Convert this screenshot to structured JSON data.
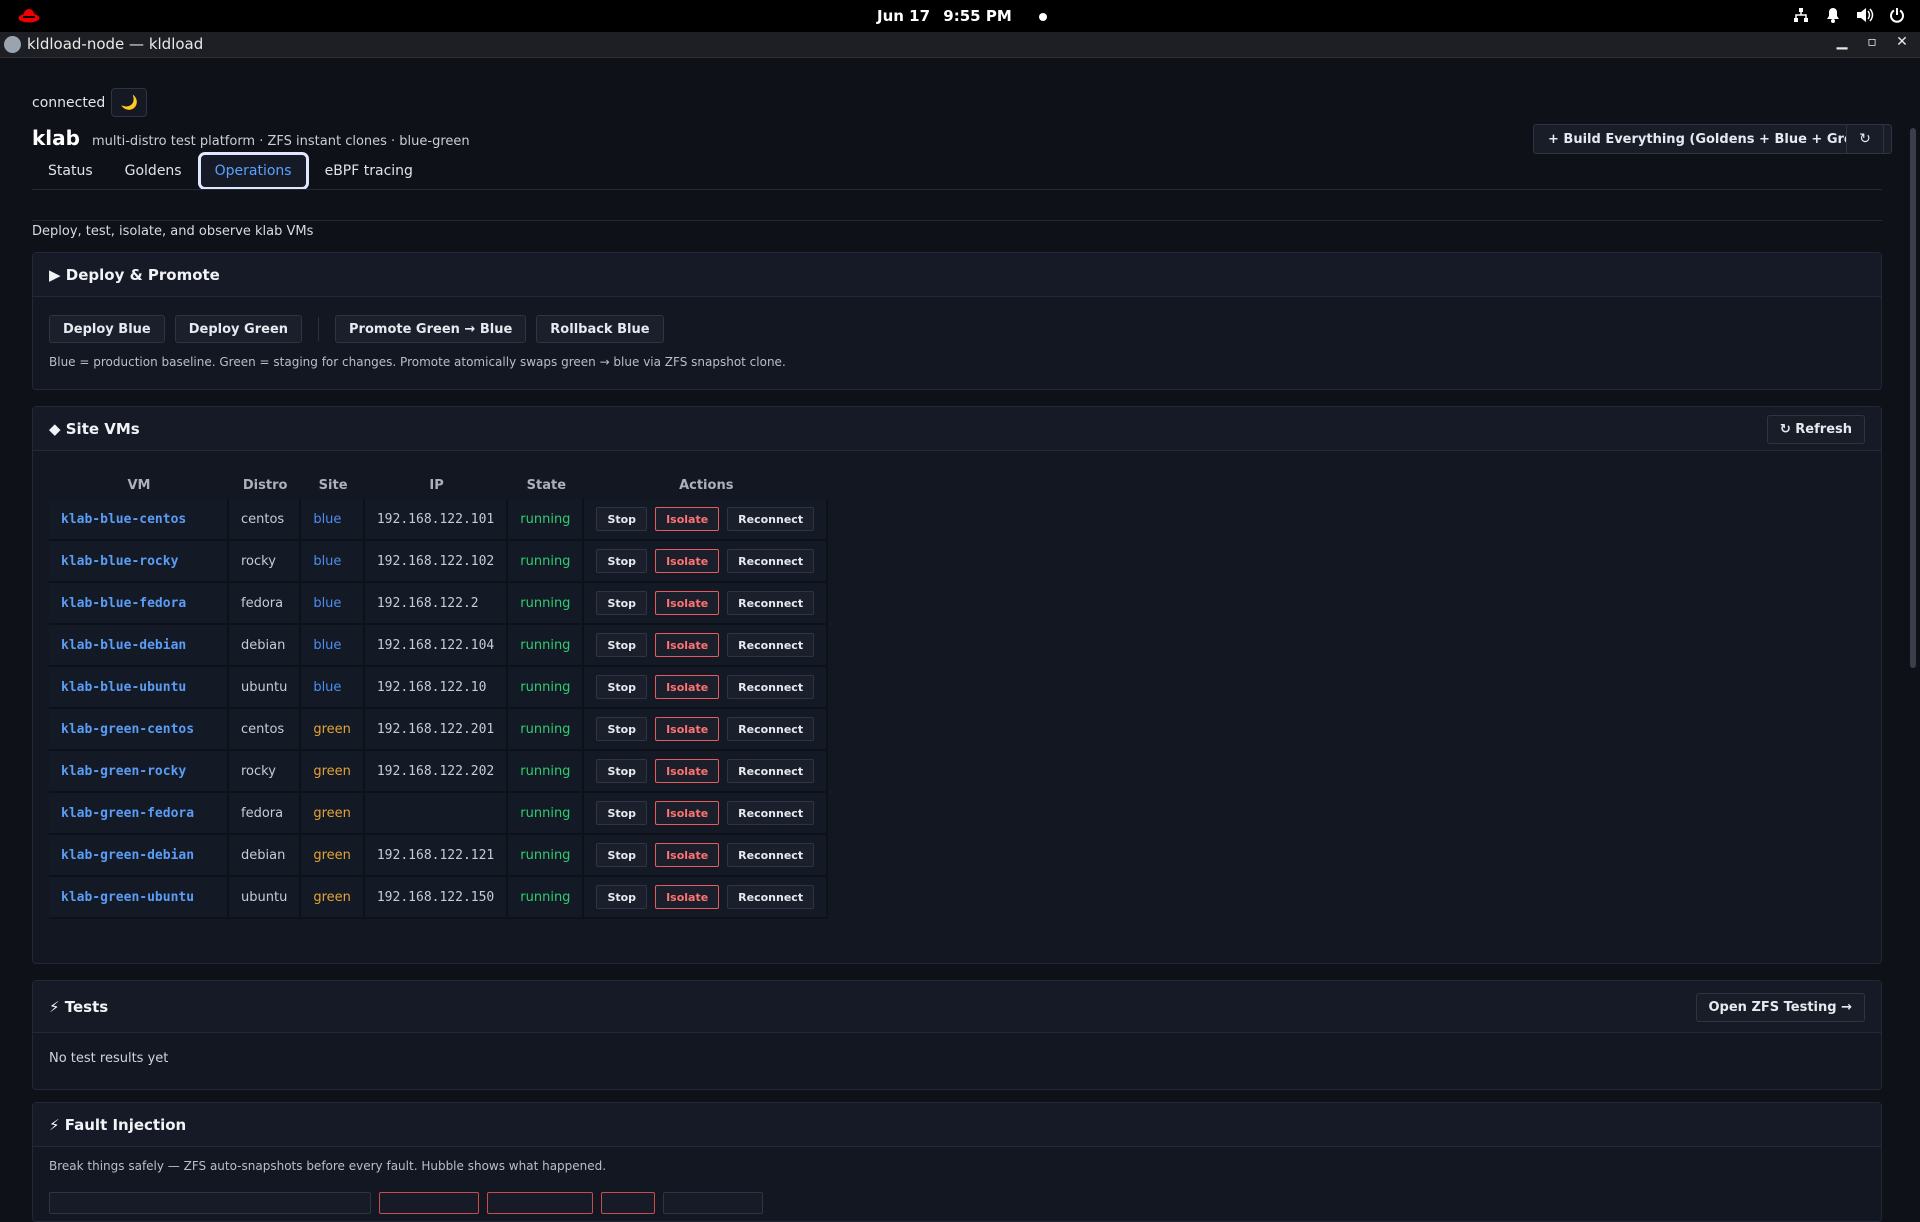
{
  "topbar": {
    "date": "Jun 17",
    "time": "9:55 PM",
    "tray_icons": [
      "network-icon",
      "notification-icon",
      "volume-icon",
      "power-icon"
    ]
  },
  "window": {
    "title": "kldload-node — kldload"
  },
  "header": {
    "connection_status": "connected",
    "theme_icon": "🌙",
    "app_name": "klab",
    "subtitle": "multi-distro test platform · ZFS instant clones · blue-green",
    "build_label": "+ Build Everything (Goldens + Blue + Green)",
    "reload_label": "↻"
  },
  "tabs": [
    {
      "label": "Status",
      "active": false
    },
    {
      "label": "Goldens",
      "active": false
    },
    {
      "label": "Operations",
      "active": true
    },
    {
      "label": "eBPF tracing",
      "active": false
    }
  ],
  "page_description": "Deploy, test, isolate, and observe klab VMs",
  "deploy": {
    "title": "▶ Deploy & Promote",
    "buttons": [
      "Deploy Blue",
      "Deploy Green",
      "Promote Green → Blue",
      "Rollback Blue"
    ],
    "note": "Blue = production baseline. Green = staging for changes. Promote atomically swaps green → blue via ZFS snapshot clone."
  },
  "site_vms": {
    "title": "◆ Site VMs",
    "refresh_label": "↻ Refresh",
    "columns": [
      "VM",
      "Distro",
      "Site",
      "IP",
      "State",
      "Actions"
    ],
    "action_labels": {
      "stop": "Stop",
      "isolate": "Isolate",
      "reconnect": "Reconnect"
    },
    "rows": [
      {
        "vm": "klab-blue-centos",
        "distro": "centos",
        "site": "blue",
        "ip": "192.168.122.101",
        "state": "running"
      },
      {
        "vm": "klab-blue-rocky",
        "distro": "rocky",
        "site": "blue",
        "ip": "192.168.122.102",
        "state": "running"
      },
      {
        "vm": "klab-blue-fedora",
        "distro": "fedora",
        "site": "blue",
        "ip": "192.168.122.2",
        "state": "running"
      },
      {
        "vm": "klab-blue-debian",
        "distro": "debian",
        "site": "blue",
        "ip": "192.168.122.104",
        "state": "running"
      },
      {
        "vm": "klab-blue-ubuntu",
        "distro": "ubuntu",
        "site": "blue",
        "ip": "192.168.122.10",
        "state": "running"
      },
      {
        "vm": "klab-green-centos",
        "distro": "centos",
        "site": "green",
        "ip": "192.168.122.201",
        "state": "running"
      },
      {
        "vm": "klab-green-rocky",
        "distro": "rocky",
        "site": "green",
        "ip": "192.168.122.202",
        "state": "running"
      },
      {
        "vm": "klab-green-fedora",
        "distro": "fedora",
        "site": "green",
        "ip": "",
        "state": "running"
      },
      {
        "vm": "klab-green-debian",
        "distro": "debian",
        "site": "green",
        "ip": "192.168.122.121",
        "state": "running"
      },
      {
        "vm": "klab-green-ubuntu",
        "distro": "ubuntu",
        "site": "green",
        "ip": "192.168.122.150",
        "state": "running"
      }
    ]
  },
  "tests": {
    "title": "⚡ Tests",
    "open_label": "Open ZFS Testing →",
    "empty_text": "No test results yet"
  },
  "fault": {
    "title": "⚡ Fault Injection",
    "description": "Break things safely — ZFS auto-snapshots before every fault. Hubble shows what happened."
  },
  "colors": {
    "background": "#0e1118",
    "accent_blue": "#5b9cf5",
    "site_green": "#e3a336",
    "running": "#2ecc71",
    "danger": "#ff7373"
  }
}
